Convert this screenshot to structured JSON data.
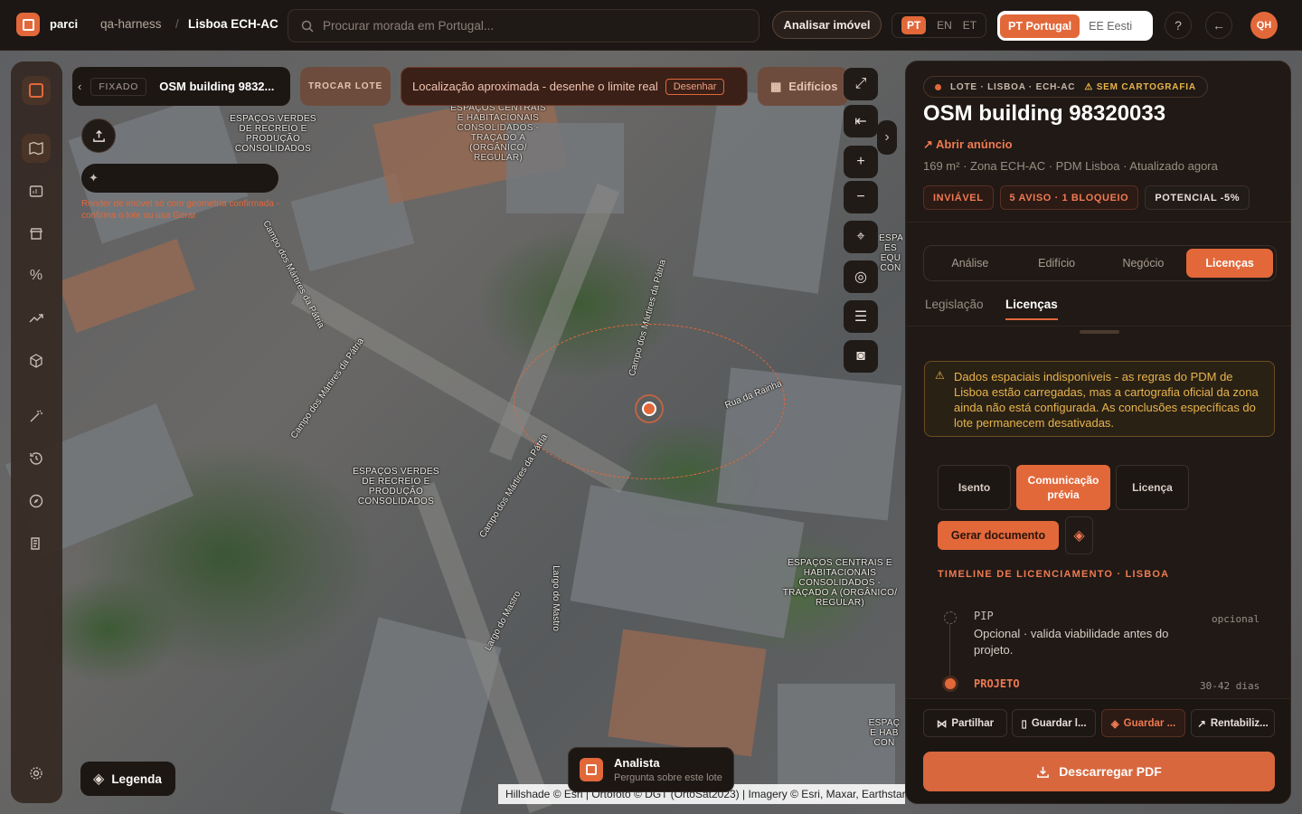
{
  "topbar": {
    "brand": "parci",
    "workspace": "qa-harness",
    "separator": "/",
    "project": "Lisboa ECH-AC",
    "search_placeholder": "Procurar morada em Portugal...",
    "analyze_button": "Analisar imóvel",
    "languages": [
      "PT",
      "EN",
      "ET"
    ],
    "active_language": "PT",
    "country_active": "PT Portugal",
    "country_other": "EE Eesti",
    "user_initials": "QH"
  },
  "map_toolbar": {
    "pinned_badge": "FIXADO",
    "building_name": "OSM building 9832...",
    "swap_lot": "TROCAR LOTE",
    "approx_location": "Localização aproximada - desenhe o limite real",
    "draw_button": "Desenhar",
    "buildings_toggle": "Edifícios"
  },
  "render_notice": "Render de imóvel só com geometria confirmada - confirma o lote ou usa Gerar",
  "map_labels": {
    "zone_1": "ESPAÇOS VERDES DE RECREIO E PRODUÇÃO CONSOLIDADOS",
    "zone_2": "ESPAÇOS CENTRAIS E HABITACIONAIS CONSOLIDADOS - TRAÇADO A (ORGÂNICO/ REGULAR)",
    "zone_3": "ESPAÇOS VERDES DE RECREIO E PRODUÇÃO CONSOLIDADOS",
    "zone_4": "ESPAÇOS CENTRAIS E HABITACIONAIS CONSOLIDADOS - TRAÇADO A (ORGÂNICO/ REGULAR)",
    "zone_5_partial": "ESPA ES EQU CON",
    "zone_6_partial": "ESPAÇ E HAB CON",
    "street_1": "Campo dos Mártires da Pátria",
    "street_2": "Campo dos Mártires da Pátria",
    "street_3": "Largo do Mastro",
    "street_4": "Largo do Mastro",
    "street_5": "Rua da Rainha",
    "street_6": "Campo dos Mártires da Pátria",
    "street_7": "Campo dos Mártires da Pátria"
  },
  "legend_button": "Legenda",
  "analyst": {
    "title": "Analista",
    "subtitle": "Pergunta sobre este lote"
  },
  "attribution": "Hillshade © Esri | Ortofoto © DGT (OrtoSat2023) | Imagery © Esri, Maxar, Earthstar",
  "panel": {
    "breadcrumb": "LOTE · LISBOA · ECH-AC",
    "no_mapping": "SEM CARTOGRAFIA",
    "title": "OSM building 98320033",
    "open_listing": "Abrir anúncio",
    "meta": "169 m² · Zona ECH-AC · PDM Lisboa · Atualizado agora",
    "badges": [
      "INVIÁVEL",
      "5 AVISO · 1 BLOQUEIO",
      "POTENCIAL -5%"
    ],
    "tabs": [
      "Análise",
      "Edifício",
      "Negócio",
      "Licenças"
    ],
    "active_tab": "Licenças",
    "subtabs": [
      "Legislação",
      "Licenças"
    ],
    "active_subtab": "Licenças",
    "warning": "Dados espaciais indisponíveis - as regras do PDM de Lisboa estão carregadas, mas a cartografia oficial da zona ainda não está configurada. As conclusões específicas do lote permanecem desativadas.",
    "license_types": [
      "Isento",
      "Comunicação prévia",
      "Licença"
    ],
    "active_license": "Comunicação prévia",
    "generate_doc": "Gerar documento",
    "timeline_title": "TIMELINE DE LICENCIAMENTO · LISBOA",
    "timeline": [
      {
        "step": "PIP",
        "tag": "opcional",
        "desc": "Opcional · valida viabilidade antes do projeto."
      },
      {
        "step": "PROJETO",
        "tag": "30-42 dias",
        "desc": ""
      }
    ],
    "actions": [
      "Partilhar",
      "Guardar l...",
      "Guardar ...",
      "Rentabiliz..."
    ],
    "download_pdf": "Descarregar PDF"
  },
  "colors": {
    "accent": "#e2683a",
    "warning": "#e8b44c",
    "panel_bg": "#201915"
  }
}
